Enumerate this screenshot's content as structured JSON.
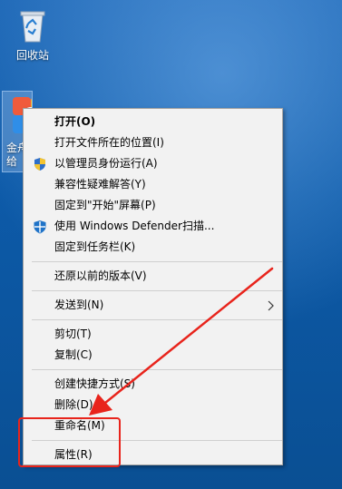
{
  "desktop": {
    "recycle_bin_label": "回收站",
    "app_label_line1": "金舟",
    "app_label_line2": "给"
  },
  "menu": {
    "items": [
      {
        "label": "打开(O)"
      },
      {
        "label": "打开文件所在的位置(I)"
      },
      {
        "label": "以管理员身份运行(A)",
        "icon": "uac-shield-icon"
      },
      {
        "label": "兼容性疑难解答(Y)"
      },
      {
        "label": "固定到\"开始\"屏幕(P)"
      },
      {
        "label": "使用 Windows Defender扫描...",
        "icon": "defender-shield-icon"
      },
      {
        "label": "固定到任务栏(K)"
      },
      {
        "label": "还原以前的版本(V)"
      },
      {
        "label": "发送到(N)"
      },
      {
        "label": "剪切(T)"
      },
      {
        "label": "复制(C)"
      },
      {
        "label": "创建快捷方式(S)"
      },
      {
        "label": "删除(D)"
      },
      {
        "label": "重命名(M)"
      },
      {
        "label": "属性(R)"
      }
    ]
  },
  "colors": {
    "annotation": "#e8241c",
    "menu_background": "#f2f2f2",
    "desktop_background": "#0a4f93"
  }
}
